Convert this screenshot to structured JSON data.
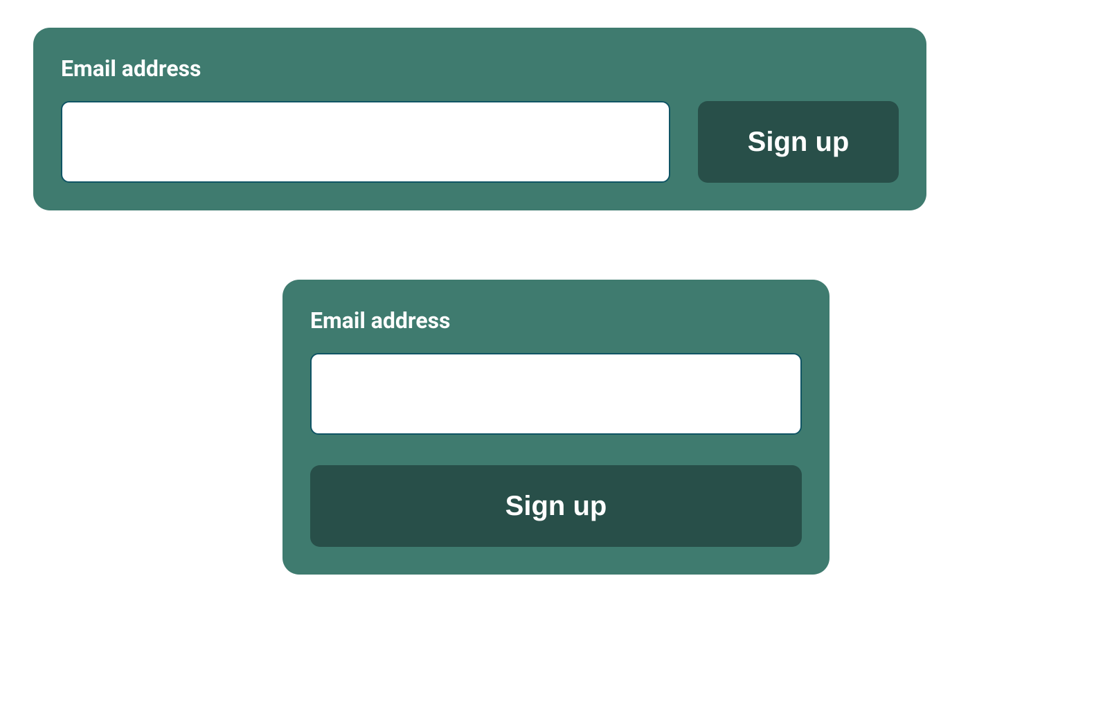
{
  "form_wide": {
    "label": "Email address",
    "input_value": "",
    "input_placeholder": "",
    "button_label": "Sign up"
  },
  "form_narrow": {
    "label": "Email address",
    "input_value": "",
    "input_placeholder": "",
    "button_label": "Sign up"
  }
}
